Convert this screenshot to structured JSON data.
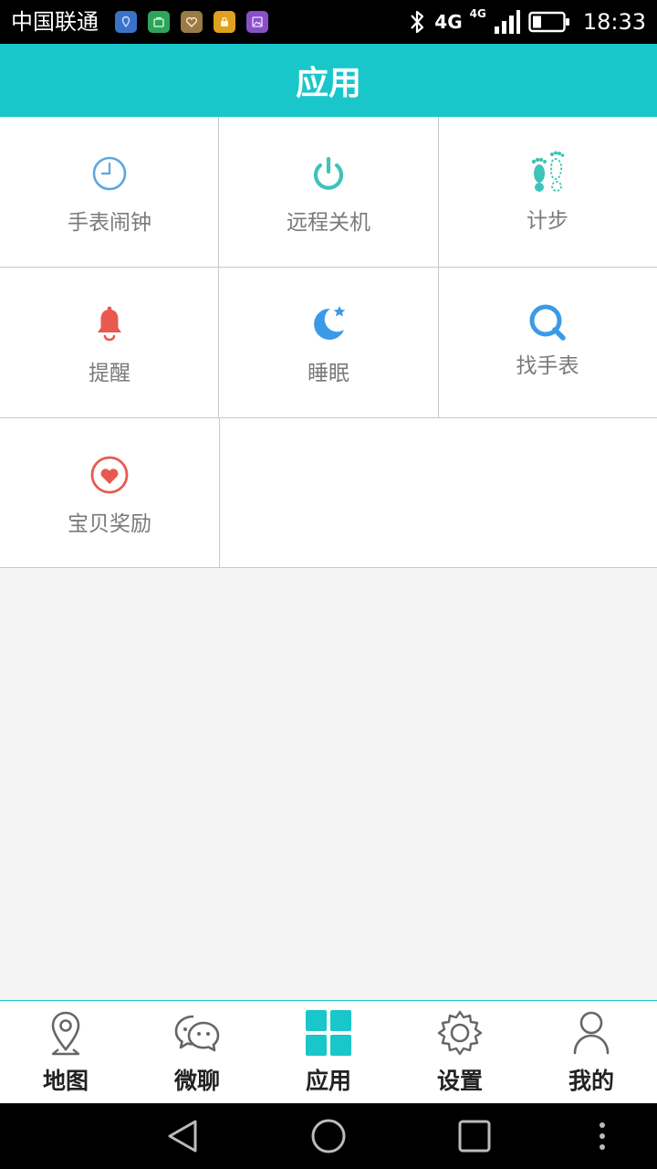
{
  "status_bar": {
    "carrier": "中国联通",
    "network": "4G",
    "network_secondary": "4G",
    "time": "18:33",
    "notification_icons": [
      {
        "name": "location-app-icon",
        "color": "#3a72c8"
      },
      {
        "name": "briefcase-app-icon",
        "color": "#2ea35a"
      },
      {
        "name": "health-app-icon",
        "color": "#9a7a45"
      },
      {
        "name": "lock-app-icon",
        "color": "#e0a020"
      },
      {
        "name": "gallery-app-icon",
        "color": "#8a4fc8"
      }
    ]
  },
  "header": {
    "title": "应用",
    "background": "#19c7cb"
  },
  "apps": [
    {
      "id": "watch-alarm",
      "label": "手表闹钟",
      "icon": "clock-icon",
      "color": "#5aa8e0"
    },
    {
      "id": "remote-shutdown",
      "label": "远程关机",
      "icon": "power-icon",
      "color": "#3fc3b8"
    },
    {
      "id": "step-count",
      "label": "计步",
      "icon": "footprints-icon",
      "color": "#3fc3b8"
    },
    {
      "id": "reminder",
      "label": "提醒",
      "icon": "bell-icon",
      "color": "#e85a4f"
    },
    {
      "id": "sleep",
      "label": "睡眠",
      "icon": "moon-star-icon",
      "color": "#3a9ae8"
    },
    {
      "id": "find-watch",
      "label": "找手表",
      "icon": "search-icon",
      "color": "#3a9ae8"
    },
    {
      "id": "baby-reward",
      "label": "宝贝奖励",
      "icon": "heart-icon",
      "color": "#e85a4f"
    }
  ],
  "bottom_nav": {
    "active_color": "#19c7cb",
    "items": [
      {
        "id": "map",
        "label": "地图",
        "icon": "map-pin-icon",
        "active": false
      },
      {
        "id": "chat",
        "label": "微聊",
        "icon": "chat-bubbles-icon",
        "active": false
      },
      {
        "id": "apps",
        "label": "应用",
        "icon": "grid-icon",
        "active": true
      },
      {
        "id": "settings",
        "label": "设置",
        "icon": "gear-icon",
        "active": false
      },
      {
        "id": "mine",
        "label": "我的",
        "icon": "person-icon",
        "active": false
      }
    ]
  }
}
